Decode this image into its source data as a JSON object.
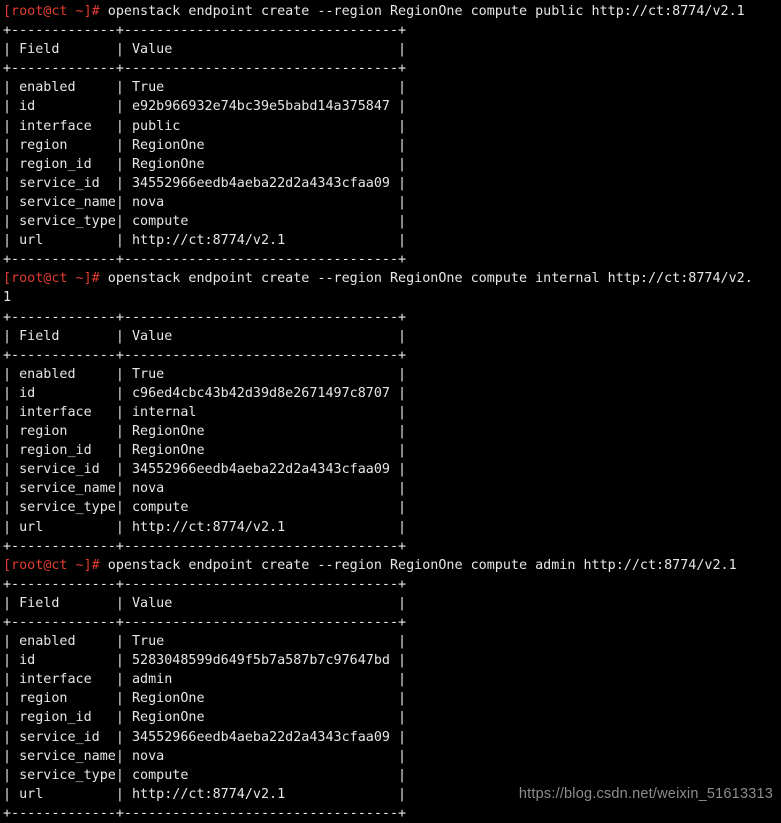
{
  "terminal": {
    "prompt": "[root@ct ~]#",
    "colors": {
      "background": "#000000",
      "foreground": "#e6e6e6",
      "prompt": "#e03c31",
      "watermark": "#8d8d8d"
    },
    "blocks": [
      {
        "command": " openstack endpoint create --region RegionOne compute public http://ct:8774/v2.1",
        "command_wrap": "",
        "table": {
          "rule": "+-------------+----------------------------------+",
          "headers": [
            "Field",
            "Value"
          ],
          "header_row": "| Field       | Value                            |",
          "rows": [
            {
              "field": "enabled",
              "value": "True"
            },
            {
              "field": "id",
              "value": "e92b966932e74bc39e5babd14a375847"
            },
            {
              "field": "interface",
              "value": "public"
            },
            {
              "field": "region",
              "value": "RegionOne"
            },
            {
              "field": "region_id",
              "value": "RegionOne"
            },
            {
              "field": "service_id",
              "value": "34552966eedb4aeba22d2a4343cfaa09"
            },
            {
              "field": "service_name",
              "value": "nova"
            },
            {
              "field": "service_type",
              "value": "compute"
            },
            {
              "field": "url",
              "value": "http://ct:8774/v2.1"
            }
          ],
          "row_lines": [
            "| enabled     | True                             |",
            "| id          | e92b966932e74bc39e5babd14a375847 |",
            "| interface   | public                           |",
            "| region      | RegionOne                        |",
            "| region_id   | RegionOne                        |",
            "| service_id  | 34552966eedb4aeba22d2a4343cfaa09 |",
            "| service_name | nova                            |",
            "| service_type | compute                         |",
            "| url         | http://ct:8774/v2.1              |"
          ]
        }
      },
      {
        "command": " openstack endpoint create --region RegionOne compute internal http://ct:8774/v2.",
        "command_wrap": "1",
        "table": {
          "rule": "+-------------+----------------------------------+",
          "headers": [
            "Field",
            "Value"
          ],
          "header_row": "| Field       | Value                            |",
          "rows": [
            {
              "field": "enabled",
              "value": "True"
            },
            {
              "field": "id",
              "value": "c96ed4cbc43b42d39d8e2671497c8707"
            },
            {
              "field": "interface",
              "value": "internal"
            },
            {
              "field": "region",
              "value": "RegionOne"
            },
            {
              "field": "region_id",
              "value": "RegionOne"
            },
            {
              "field": "service_id",
              "value": "34552966eedb4aeba22d2a4343cfaa09"
            },
            {
              "field": "service_name",
              "value": "nova"
            },
            {
              "field": "service_type",
              "value": "compute"
            },
            {
              "field": "url",
              "value": "http://ct:8774/v2.1"
            }
          ],
          "row_lines": [
            "| enabled     | True                             |",
            "| id          | c96ed4cbc43b42d39d8e2671497c8707 |",
            "| interface   | internal                         |",
            "| region      | RegionOne                        |",
            "| region_id   | RegionOne                        |",
            "| service_id  | 34552966eedb4aeba22d2a4343cfaa09 |",
            "| service_name | nova                            |",
            "| service_type | compute                         |",
            "| url         | http://ct:8774/v2.1              |"
          ]
        }
      },
      {
        "command": " openstack endpoint create --region RegionOne compute admin http://ct:8774/v2.1",
        "command_wrap": "",
        "table": {
          "rule": "+-------------+----------------------------------+",
          "headers": [
            "Field",
            "Value"
          ],
          "header_row": "| Field       | Value                            |",
          "rows": [
            {
              "field": "enabled",
              "value": "True"
            },
            {
              "field": "id",
              "value": "5283048599d649f5b7a587b7c97647bd"
            },
            {
              "field": "interface",
              "value": "admin"
            },
            {
              "field": "region",
              "value": "RegionOne"
            },
            {
              "field": "region_id",
              "value": "RegionOne"
            },
            {
              "field": "service_id",
              "value": "34552966eedb4aeba22d2a4343cfaa09"
            },
            {
              "field": "service_name",
              "value": "nova"
            },
            {
              "field": "service_type",
              "value": "compute"
            },
            {
              "field": "url",
              "value": "http://ct:8774/v2.1"
            }
          ],
          "row_lines": [
            "| enabled     | True                             |",
            "| id          | 5283048599d649f5b7a587b7c97647bd |",
            "| interface   | admin                            |",
            "| region      | RegionOne                        |",
            "| region_id   | RegionOne                        |",
            "| service_id  | 34552966eedb4aeba22d2a4343cfaa09 |",
            "| service_name | nova                            |",
            "| service_type | compute                         |",
            "| url         | http://ct:8774/v2.1              |"
          ]
        }
      }
    ]
  },
  "watermark": {
    "text": "https://blog.csdn.net/weixin_51613313"
  }
}
